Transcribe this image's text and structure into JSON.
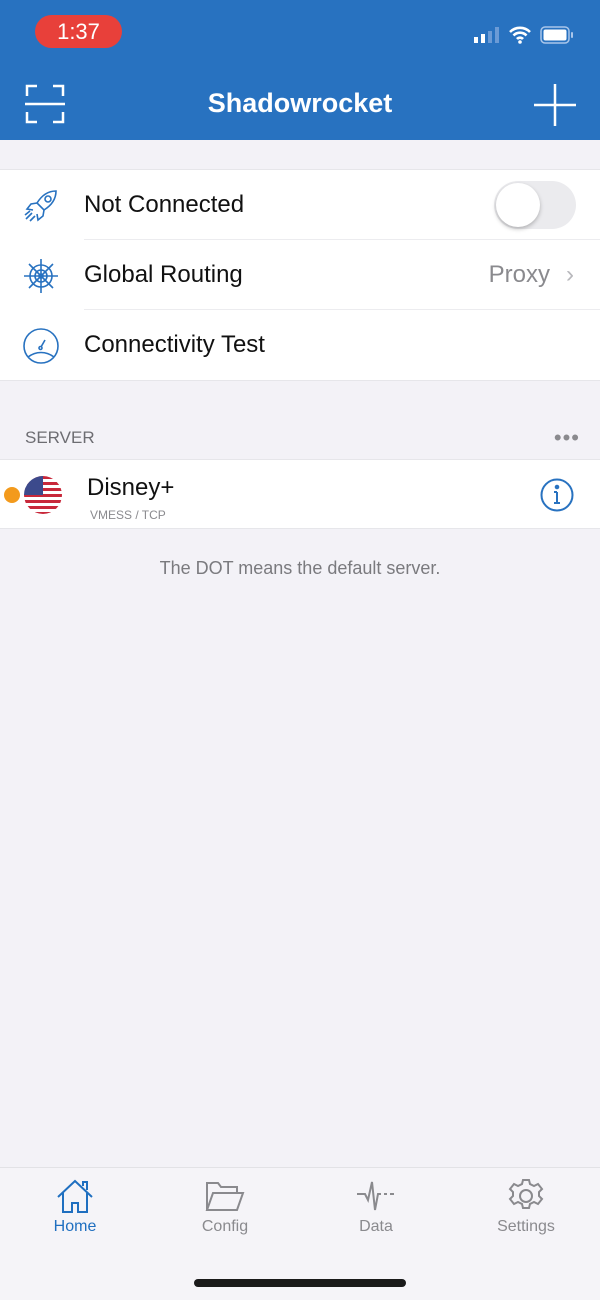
{
  "status_bar": {
    "time": "1:37"
  },
  "header": {
    "title": "Shadowrocket"
  },
  "main": {
    "connection": {
      "label": "Not Connected",
      "toggle_on": false
    },
    "routing": {
      "label": "Global Routing",
      "value": "Proxy"
    },
    "test": {
      "label": "Connectivity Test"
    },
    "server_section": {
      "title": "SERVER",
      "more": "•••"
    },
    "server": {
      "name": "Disney+",
      "type": "VMESS / TCP",
      "default": true
    },
    "hint": "The DOT means the default server."
  },
  "tabs": [
    {
      "label": "Home"
    },
    {
      "label": "Config"
    },
    {
      "label": "Data"
    },
    {
      "label": "Settings"
    }
  ],
  "colors": {
    "brand": "#2872c0",
    "default_dot": "#f39a1c"
  }
}
